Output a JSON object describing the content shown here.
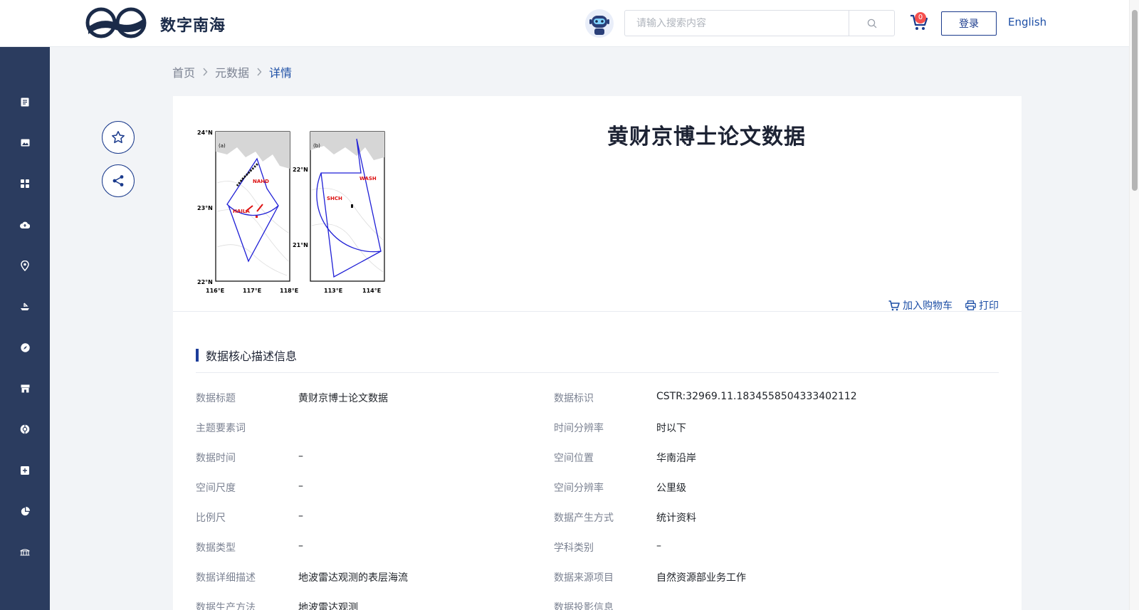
{
  "header": {
    "site_title": "数字南海",
    "search_placeholder": "请输入搜索内容",
    "cart_count": "0",
    "login_label": "登录",
    "lang_label": "English"
  },
  "nav_icons": [
    "document-icon",
    "image-icon",
    "grid-icon",
    "cloud-upload-icon",
    "location-pin-icon",
    "ship-icon",
    "compass-icon",
    "store-icon",
    "globe-icon",
    "plus-square-icon",
    "pie-chart-icon",
    "bridge-icon"
  ],
  "breadcrumb": {
    "home": "首页",
    "metadata": "元数据",
    "current": "详情"
  },
  "dataset": {
    "title": "黄财京博士论文数据",
    "add_to_cart": "加入购物车",
    "print": "打印"
  },
  "figure": {
    "panel_a": "(a)",
    "panel_b": "(b)",
    "lat_a": [
      "24°N",
      "23°N",
      "22°N"
    ],
    "lon_a": [
      "116°E",
      "117°E",
      "118°E"
    ],
    "lat_b": [
      "22°N",
      "21°N"
    ],
    "lon_b": [
      "113°E",
      "114°E"
    ],
    "stations": [
      "NAHD",
      "HAILA",
      "SHCH",
      "WASH"
    ]
  },
  "section": {
    "title": "数据核心描述信息"
  },
  "metadata": [
    {
      "label1": "数据标题",
      "value1": "黄财京博士论文数据",
      "label2": "数据标识",
      "value2": "CSTR:32969.11.1834558504333402112"
    },
    {
      "label1": "主题要素词",
      "value1": "",
      "label2": "时间分辨率",
      "value2": "时以下"
    },
    {
      "label1": "数据时间",
      "value1": "–",
      "label2": "空间位置",
      "value2": "华南沿岸"
    },
    {
      "label1": "空间尺度",
      "value1": "–",
      "label2": "空间分辨率",
      "value2": "公里级"
    },
    {
      "label1": "比例尺",
      "value1": "–",
      "label2": "数据产生方式",
      "value2": "统计资料"
    },
    {
      "label1": "数据类型",
      "value1": "–",
      "label2": "学科类别",
      "value2": "–"
    },
    {
      "label1": "数据详细描述",
      "value1": "地波雷达观测的表层海流",
      "label2": "数据来源项目",
      "value2": "自然资源部业务工作"
    },
    {
      "label1": "数据生产方法",
      "value1": "地波雷达观测",
      "label2": "数据投影信息",
      "value2": ""
    }
  ]
}
